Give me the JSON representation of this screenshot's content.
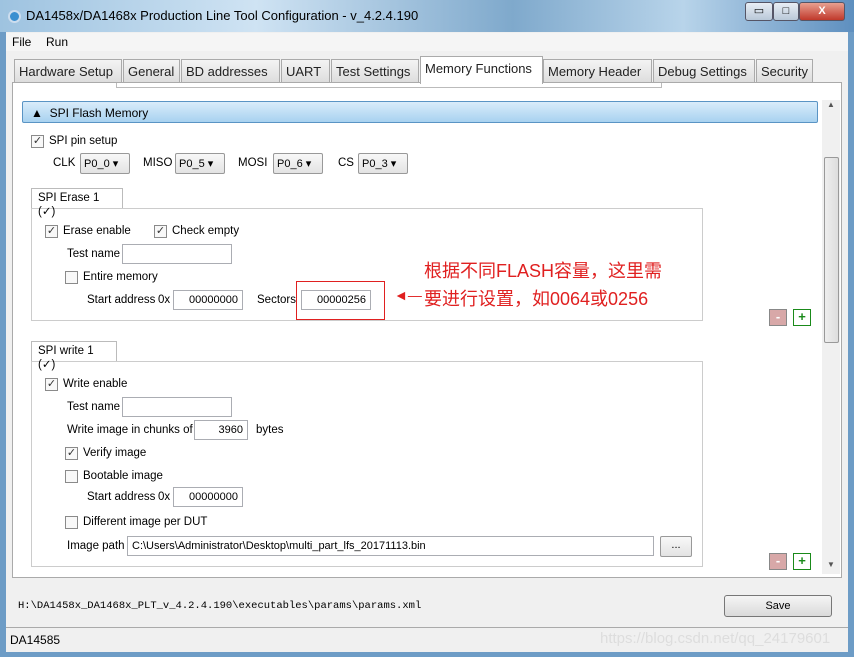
{
  "window": {
    "title": "DA1458x/DA1468x Production Line Tool Configuration - v_4.2.4.190",
    "minimize": "▭",
    "maximize": "□",
    "close": "X"
  },
  "menu": [
    "File",
    "Run"
  ],
  "tabs": [
    "Hardware Setup",
    "General",
    "BD addresses",
    "UART",
    "Test Settings",
    "Memory Functions",
    "Memory Header",
    "Debug Settings",
    "Security"
  ],
  "active_tab": "Memory Functions",
  "section": {
    "arrow": "▲",
    "title": "SPI Flash Memory"
  },
  "spi_pin": {
    "label": "SPI pin setup",
    "checked": true,
    "clk_label": "CLK",
    "clk": "P0_0",
    "miso_label": "MISO",
    "miso": "P0_5",
    "mosi_label": "MOSI",
    "mosi": "P0_6",
    "cs_label": "CS",
    "cs": "P0_3"
  },
  "erase": {
    "tab": "SPI Erase 1 (✓)",
    "erase_enable": "Erase enable",
    "check_empty": "Check empty",
    "test_name": "Test name",
    "test_name_value": "",
    "entire_memory": "Entire memory",
    "start_address": "Start address",
    "hex": "0x",
    "start_value": "00000000",
    "sectors": "Sectors",
    "sectors_value": "00000256"
  },
  "write": {
    "tab": "SPI write 1 (✓)",
    "write_enable": "Write enable",
    "test_name": "Test name",
    "test_name_value": "",
    "chunks_label": "Write image in chunks of",
    "chunks_value": "3960",
    "bytes": "bytes",
    "verify": "Verify image",
    "bootable": "Bootable image",
    "start_address": "Start address",
    "hex": "0x",
    "start_value": "00000000",
    "different": "Different image per DUT",
    "image_path": "Image path",
    "image_path_value": "C:\\Users\\Administrator\\Desktop\\multi_part_lfs_20171113.bin",
    "browse": "..."
  },
  "buttons": {
    "remove": "-",
    "add": "+"
  },
  "annotation": {
    "line1": "根据不同FLASH容量，这里需",
    "line2": "要进行设置，如0064或0256",
    "arrow": "◄—"
  },
  "footer": {
    "path": "H:\\DA1458x_DA1468x_PLT_v_4.2.4.190\\executables\\params\\params.xml",
    "save": "Save",
    "status": "DA14585",
    "watermark": "https://blog.csdn.net/qq_24179601"
  },
  "colors": {
    "annotation": "#e02020",
    "section_header": "#a8d2f0",
    "add": "#1a8a1a",
    "remove": "#d49a9a"
  }
}
